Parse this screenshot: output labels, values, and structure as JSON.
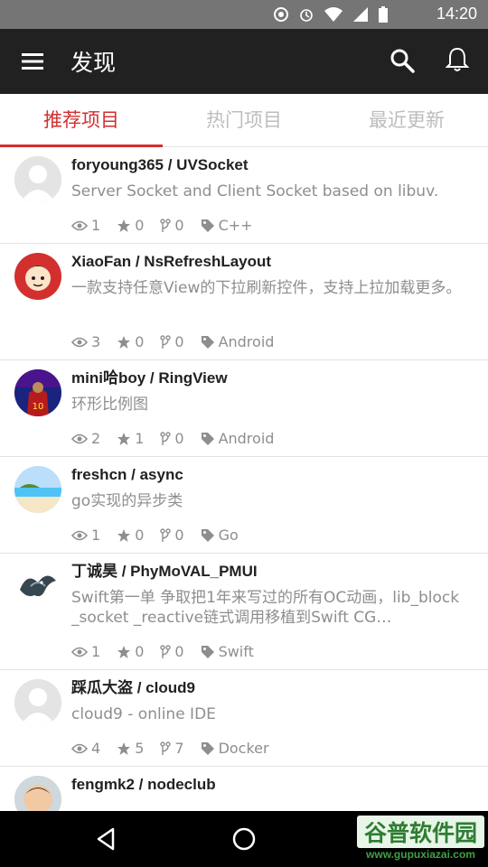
{
  "status_bar": {
    "time": "14:20"
  },
  "app_bar": {
    "title": "发现"
  },
  "tabs": [
    {
      "label": "推荐项目",
      "active": true
    },
    {
      "label": "热门项目",
      "active": false
    },
    {
      "label": "最近更新",
      "active": false
    }
  ],
  "repos": [
    {
      "title": "foryoung365 / UVSocket",
      "description": "Server Socket and Client Socket based on libuv.",
      "watchers": "1",
      "stars": "0",
      "forks": "0",
      "language": "C++",
      "avatar": "default-avatar"
    },
    {
      "title": "XiaoFan / NsRefreshLayout",
      "description": "一款支持任意View的下拉刷新控件，支持上拉加载更多。",
      "watchers": "3",
      "stars": "0",
      "forks": "0",
      "language": "Android",
      "avatar": "cartoon-avatar"
    },
    {
      "title": "mini哈boy / RingView",
      "description": "环形比例图",
      "watchers": "2",
      "stars": "1",
      "forks": "0",
      "language": "Android",
      "avatar": "football-avatar"
    },
    {
      "title": "freshcn / async",
      "description": "go实现的异步类",
      "watchers": "1",
      "stars": "0",
      "forks": "0",
      "language": "Go",
      "avatar": "beach-avatar"
    },
    {
      "title": "丁诚昊 / PhyMoVAL_PMUI",
      "description": "Swift第一单 争取把1年来写过的所有OC动画，lib_block _socket _reactive链式调用移植到Swift CG…",
      "watchers": "1",
      "stars": "0",
      "forks": "0",
      "language": "Swift",
      "avatar": "dragon-avatar"
    },
    {
      "title": "踩瓜大盗 / cloud9",
      "description": "cloud9 - online IDE",
      "watchers": "4",
      "stars": "5",
      "forks": "7",
      "language": "Docker",
      "avatar": "default-avatar"
    },
    {
      "title": "fengmk2 / nodeclub",
      "description": "",
      "watchers": "",
      "stars": "",
      "forks": "",
      "language": "",
      "avatar": "photo-avatar"
    }
  ],
  "watermark": {
    "title": "谷普软件园",
    "url": "www.gupuxiazai.com"
  },
  "colors": {
    "accent": "#d32f2f",
    "appbar": "#212121",
    "statusbar": "#757575"
  }
}
